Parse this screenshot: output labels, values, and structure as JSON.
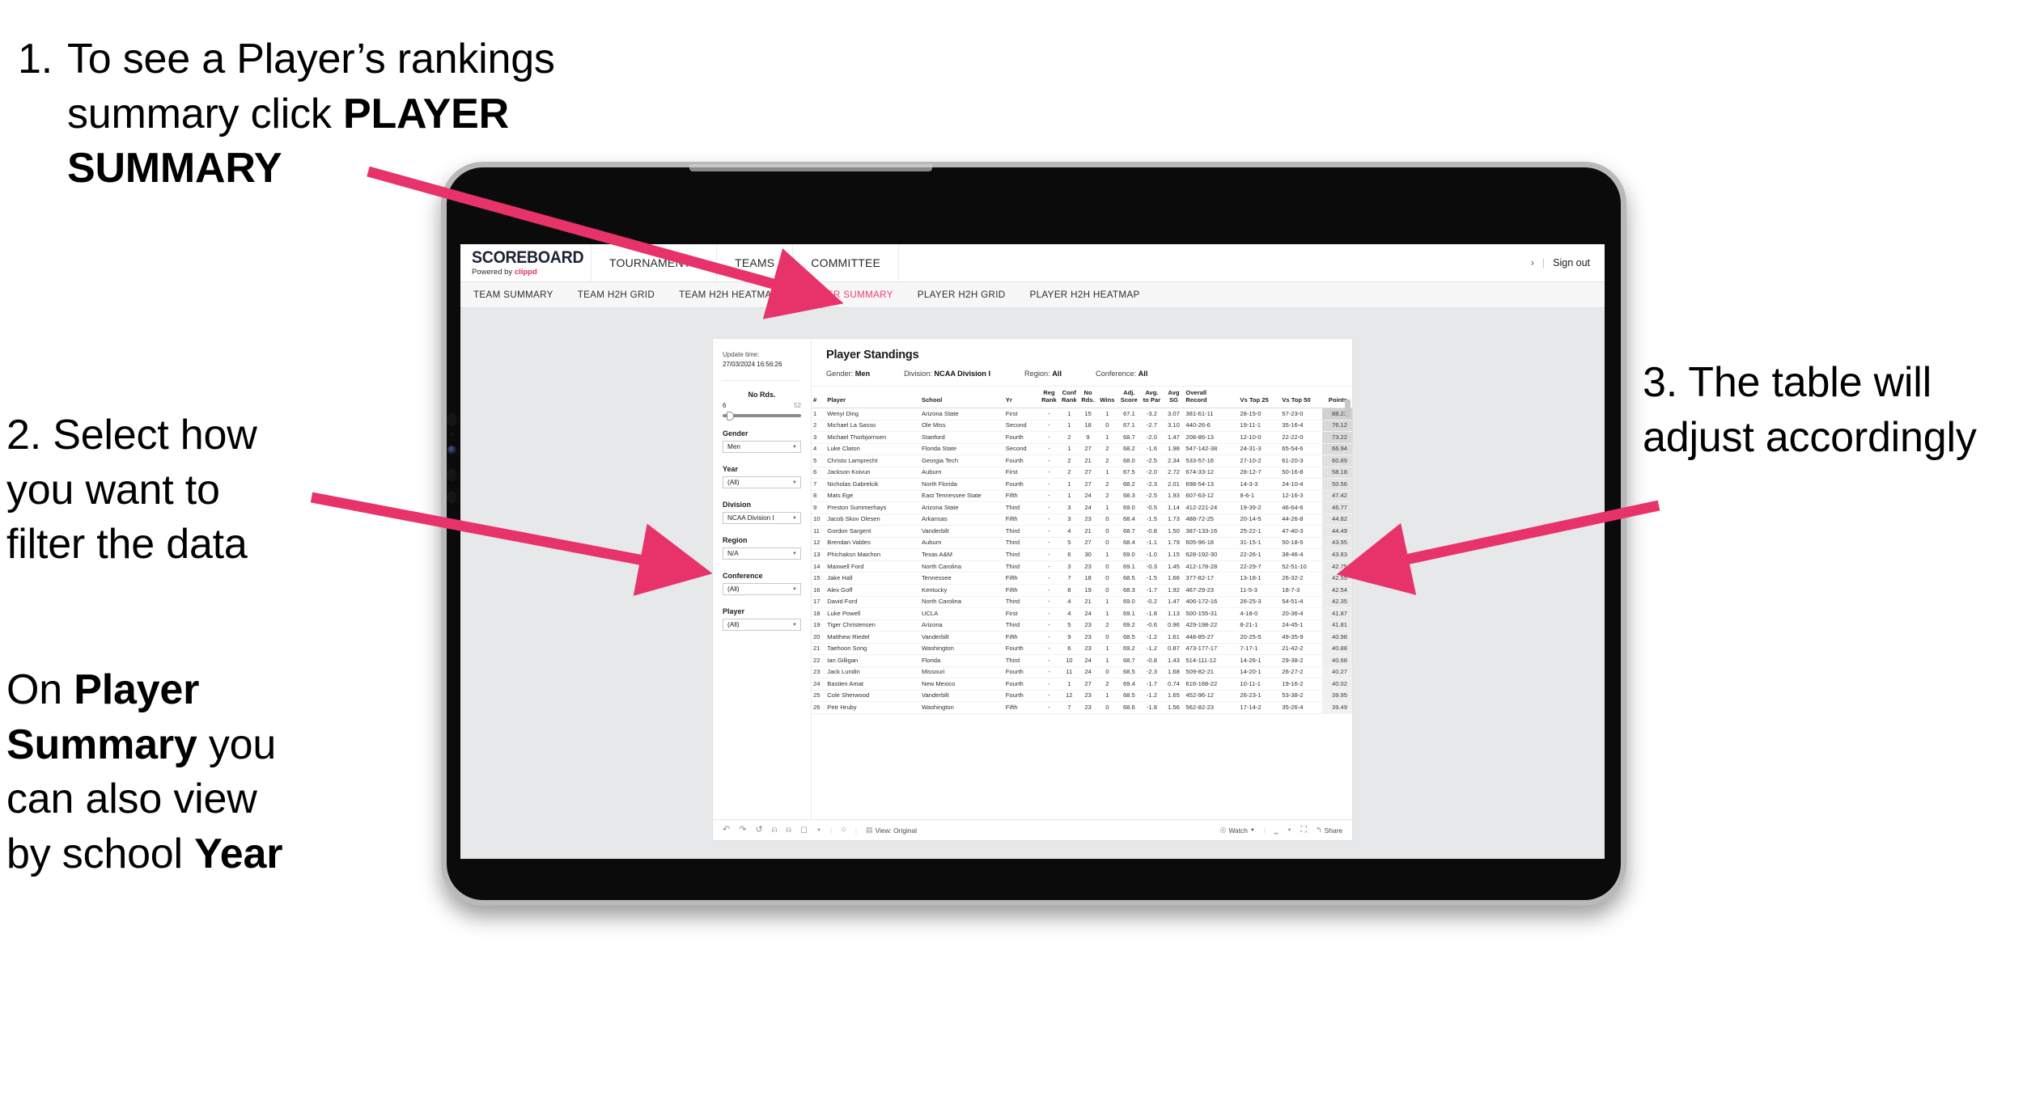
{
  "annotations": {
    "step1": {
      "number": "1.",
      "line1": "To see a Player’s rankings",
      "line2_pre": "summary click ",
      "line2_bold": "PLAYER",
      "line3_bold": "SUMMARY"
    },
    "step2": {
      "line1": "2. Select how",
      "line2": "you want to",
      "line3": "filter the data"
    },
    "step2b": {
      "line1_pre": "On ",
      "line1_bold": "Player",
      "line2_bold": "Summary",
      "line2_post": " you",
      "line3": "can also view",
      "line4_pre": "by school ",
      "line4_bold": "Year"
    },
    "step3": {
      "line1": "3. The table will",
      "line2": "adjust accordingly"
    },
    "arrow_color": "#e8336a"
  },
  "app": {
    "brand": {
      "logo": "SCOREBOARD",
      "powered_pre": "Powered by ",
      "powered_brand": "clippd",
      "brand_color": "#e2315c"
    },
    "nav": [
      {
        "label": "TOURNAMENTS",
        "name": "nav-tournaments"
      },
      {
        "label": "TEAMS",
        "name": "nav-teams"
      },
      {
        "label": "COMMITTEE",
        "name": "nav-committee"
      }
    ],
    "account": {
      "truncated": "›",
      "separator": "|",
      "sign_out": "Sign out"
    },
    "tabs": [
      {
        "label": "TEAM SUMMARY",
        "active": false
      },
      {
        "label": "TEAM H2H GRID",
        "active": false
      },
      {
        "label": "TEAM H2H HEATMAP",
        "active": false
      },
      {
        "label": "PLAYER SUMMARY",
        "active": true
      },
      {
        "label": "PLAYER H2H GRID",
        "active": false
      },
      {
        "label": "PLAYER H2H HEATMAP",
        "active": false
      }
    ],
    "active_tab_color": "#ef3e6d"
  },
  "filters": {
    "update_label": "Update time:",
    "update_time": "27/03/2024 16:56:26",
    "no_rds": {
      "label": "No Rds.",
      "min": "6",
      "max": "52",
      "handle_pct": 5
    },
    "selects": [
      {
        "label": "Gender",
        "value": "Men",
        "name": "gender-select"
      },
      {
        "label": "Year",
        "value": "(All)",
        "name": "year-select"
      },
      {
        "label": "Division",
        "value": "NCAA Division I",
        "name": "division-select"
      },
      {
        "label": "Region",
        "value": "N/A",
        "name": "region-select"
      },
      {
        "label": "Conference",
        "value": "(All)",
        "name": "conference-select"
      },
      {
        "label": "Player",
        "value": "(All)",
        "name": "player-select"
      }
    ]
  },
  "standings": {
    "title": "Player Standings",
    "meta": [
      {
        "label": "Gender:",
        "value": "Men"
      },
      {
        "label": "Division:",
        "value": "NCAA Division I"
      },
      {
        "label": "Region:",
        "value": "All"
      },
      {
        "label": "Conference:",
        "value": "All"
      }
    ],
    "columns": [
      {
        "key": "rank",
        "l1": "#",
        "l2": "",
        "cls": "c-rank"
      },
      {
        "key": "player",
        "l1": "Player",
        "l2": "",
        "cls": "c-play"
      },
      {
        "key": "school",
        "l1": "School",
        "l2": "",
        "cls": "c-sch"
      },
      {
        "key": "yr",
        "l1": "Yr",
        "l2": "",
        "cls": "c-yr"
      },
      {
        "key": "regrank",
        "l1": "Reg",
        "l2": "Rank",
        "cls": "c-rr"
      },
      {
        "key": "confrank",
        "l1": "Conf",
        "l2": "Rank",
        "cls": "c-cr"
      },
      {
        "key": "nords",
        "l1": "No",
        "l2": "Rds.",
        "cls": "c-nr"
      },
      {
        "key": "wins",
        "l1": "",
        "l2": "Wins",
        "cls": "c-wins"
      },
      {
        "key": "adj",
        "l1": "Adj.",
        "l2": "Score",
        "cls": "c-adj"
      },
      {
        "key": "atp",
        "l1": "Avg.",
        "l2": "to Par",
        "cls": "c-atp"
      },
      {
        "key": "sg",
        "l1": "Avg",
        "l2": "SG",
        "cls": "c-sg"
      },
      {
        "key": "record",
        "l1": "Overall",
        "l2": "Record",
        "cls": "c-rec"
      },
      {
        "key": "t25",
        "l1": "",
        "l2": "Vs Top 25",
        "cls": "c-t25"
      },
      {
        "key": "t50",
        "l1": "",
        "l2": "Vs Top 50",
        "cls": "c-t50"
      },
      {
        "key": "points",
        "l1": "",
        "l2": "Points",
        "cls": "c-pts"
      }
    ],
    "rows": [
      {
        "rank": "1",
        "player": "Wenyi Ding",
        "school": "Arizona State",
        "yr": "First",
        "regrank": "-",
        "confrank": "1",
        "nords": "15",
        "wins": "1",
        "adj": "67.1",
        "atp": "-3.2",
        "sg": "3.07",
        "record": "381-61-11",
        "t25": "28-15-0",
        "t50": "57-23-0",
        "points": "88.22",
        "shade": 0.28
      },
      {
        "rank": "2",
        "player": "Michael La Sasso",
        "school": "Ole Miss",
        "yr": "Second",
        "regrank": "-",
        "confrank": "1",
        "nords": "18",
        "wins": "0",
        "adj": "67.1",
        "atp": "-2.7",
        "sg": "3.10",
        "record": "440-26-6",
        "t25": "19-11-1",
        "t50": "35-16-4",
        "points": "76.12",
        "shade": 0.24
      },
      {
        "rank": "3",
        "player": "Michael Thorbjornsen",
        "school": "Stanford",
        "yr": "Fourth",
        "regrank": "-",
        "confrank": "2",
        "nords": "9",
        "wins": "1",
        "adj": "68.7",
        "atp": "-2.0",
        "sg": "1.47",
        "record": "208-86-13",
        "t25": "12-10-0",
        "t50": "22-22-0",
        "points": "73.22",
        "shade": 0.23
      },
      {
        "rank": "4",
        "player": "Luke Claton",
        "school": "Florida State",
        "yr": "Second",
        "regrank": "-",
        "confrank": "1",
        "nords": "27",
        "wins": "2",
        "adj": "68.2",
        "atp": "-1.6",
        "sg": "1.98",
        "record": "547-142-38",
        "t25": "24-31-3",
        "t50": "65-54-6",
        "points": "66.94",
        "shade": 0.21
      },
      {
        "rank": "5",
        "player": "Christo Lamprecht",
        "school": "Georgia Tech",
        "yr": "Fourth",
        "regrank": "-",
        "confrank": "2",
        "nords": "21",
        "wins": "2",
        "adj": "68.0",
        "atp": "-2.5",
        "sg": "2.34",
        "record": "533-57-16",
        "t25": "27-10-2",
        "t50": "61-20-3",
        "points": "60.89",
        "shade": 0.19
      },
      {
        "rank": "6",
        "player": "Jackson Koivun",
        "school": "Auburn",
        "yr": "First",
        "regrank": "-",
        "confrank": "2",
        "nords": "27",
        "wins": "1",
        "adj": "67.5",
        "atp": "-2.0",
        "sg": "2.72",
        "record": "674-33-12",
        "t25": "28-12-7",
        "t50": "50-16-8",
        "points": "58.18",
        "shade": 0.18
      },
      {
        "rank": "7",
        "player": "Nicholas Gabrelcik",
        "school": "North Florida",
        "yr": "Fourth",
        "regrank": "-",
        "confrank": "1",
        "nords": "27",
        "wins": "2",
        "adj": "68.2",
        "atp": "-2.3",
        "sg": "2.01",
        "record": "698-54-13",
        "t25": "14-3-3",
        "t50": "24-10-4",
        "points": "50.56",
        "shade": 0.16
      },
      {
        "rank": "8",
        "player": "Mats Ege",
        "school": "East Tennessee State",
        "yr": "Fifth",
        "regrank": "-",
        "confrank": "1",
        "nords": "24",
        "wins": "2",
        "adj": "68.3",
        "atp": "-2.5",
        "sg": "1.93",
        "record": "607-63-12",
        "t25": "8-6-1",
        "t50": "12-16-3",
        "points": "47.42",
        "shade": 0.15
      },
      {
        "rank": "9",
        "player": "Preston Summerhays",
        "school": "Arizona State",
        "yr": "Third",
        "regrank": "-",
        "confrank": "3",
        "nords": "24",
        "wins": "1",
        "adj": "69.0",
        "atp": "-0.5",
        "sg": "1.14",
        "record": "412-221-24",
        "t25": "19-39-2",
        "t50": "46-64-6",
        "points": "46.77",
        "shade": 0.15
      },
      {
        "rank": "10",
        "player": "Jacob Skov Olesen",
        "school": "Arkansas",
        "yr": "Fifth",
        "regrank": "-",
        "confrank": "3",
        "nords": "23",
        "wins": "0",
        "adj": "68.4",
        "atp": "-1.5",
        "sg": "1.73",
        "record": "488-72-25",
        "t25": "20-14-5",
        "t50": "44-26-8",
        "points": "44.82",
        "shade": 0.14
      },
      {
        "rank": "11",
        "player": "Gordon Sargent",
        "school": "Vanderbilt",
        "yr": "Third",
        "regrank": "-",
        "confrank": "4",
        "nords": "21",
        "wins": "0",
        "adj": "68.7",
        "atp": "-0.8",
        "sg": "1.50",
        "record": "387-133-16",
        "t25": "25-22-1",
        "t50": "47-40-3",
        "points": "44.49",
        "shade": 0.14
      },
      {
        "rank": "12",
        "player": "Brendan Valdes",
        "school": "Auburn",
        "yr": "Third",
        "regrank": "-",
        "confrank": "5",
        "nords": "27",
        "wins": "0",
        "adj": "68.4",
        "atp": "-1.1",
        "sg": "1.79",
        "record": "605-96-18",
        "t25": "31-15-1",
        "t50": "50-18-5",
        "points": "43.95",
        "shade": 0.13
      },
      {
        "rank": "13",
        "player": "Phichaksn Maichon",
        "school": "Texas A&M",
        "yr": "Third",
        "regrank": "-",
        "confrank": "6",
        "nords": "30",
        "wins": "1",
        "adj": "69.0",
        "atp": "-1.0",
        "sg": "1.15",
        "record": "628-192-30",
        "t25": "22-26-1",
        "t50": "38-46-4",
        "points": "43.83",
        "shade": 0.13
      },
      {
        "rank": "14",
        "player": "Maxwell Ford",
        "school": "North Carolina",
        "yr": "Third",
        "regrank": "-",
        "confrank": "3",
        "nords": "23",
        "wins": "0",
        "adj": "69.1",
        "atp": "-0.3",
        "sg": "1.45",
        "record": "412-178-28",
        "t25": "22-29-7",
        "t50": "52-51-10",
        "points": "42.75",
        "shade": 0.12
      },
      {
        "rank": "15",
        "player": "Jake Hall",
        "school": "Tennessee",
        "yr": "Fifth",
        "regrank": "-",
        "confrank": "7",
        "nords": "18",
        "wins": "0",
        "adj": "68.5",
        "atp": "-1.5",
        "sg": "1.66",
        "record": "377-82-17",
        "t25": "13-18-1",
        "t50": "26-32-2",
        "points": "42.55",
        "shade": 0.12
      },
      {
        "rank": "16",
        "player": "Alex Goff",
        "school": "Kentucky",
        "yr": "Fifth",
        "regrank": "-",
        "confrank": "8",
        "nords": "19",
        "wins": "0",
        "adj": "68.3",
        "atp": "-1.7",
        "sg": "1.92",
        "record": "467-29-23",
        "t25": "11-5-3",
        "t50": "18-7-3",
        "points": "42.54",
        "shade": 0.12
      },
      {
        "rank": "17",
        "player": "David Ford",
        "school": "North Carolina",
        "yr": "Third",
        "regrank": "-",
        "confrank": "4",
        "nords": "21",
        "wins": "1",
        "adj": "69.0",
        "atp": "-0.2",
        "sg": "1.47",
        "record": "406-172-16",
        "t25": "26-25-3",
        "t50": "54-51-4",
        "points": "42.35",
        "shade": 0.12
      },
      {
        "rank": "18",
        "player": "Luke Powell",
        "school": "UCLA",
        "yr": "First",
        "regrank": "-",
        "confrank": "4",
        "nords": "24",
        "wins": "1",
        "adj": "69.1",
        "atp": "-1.8",
        "sg": "1.13",
        "record": "500-155-31",
        "t25": "4-18-0",
        "t50": "20-36-4",
        "points": "41.87",
        "shade": 0.11
      },
      {
        "rank": "19",
        "player": "Tiger Christensen",
        "school": "Arizona",
        "yr": "Third",
        "regrank": "-",
        "confrank": "5",
        "nords": "23",
        "wins": "2",
        "adj": "69.2",
        "atp": "-0.6",
        "sg": "0.96",
        "record": "429-198-22",
        "t25": "8-21-1",
        "t50": "24-45-1",
        "points": "41.81",
        "shade": 0.11
      },
      {
        "rank": "20",
        "player": "Matthew Riedel",
        "school": "Vanderbilt",
        "yr": "Fifth",
        "regrank": "-",
        "confrank": "9",
        "nords": "23",
        "wins": "0",
        "adj": "68.5",
        "atp": "-1.2",
        "sg": "1.61",
        "record": "448-85-27",
        "t25": "20-25-5",
        "t50": "49-35-9",
        "points": "40.98",
        "shade": 0.1
      },
      {
        "rank": "21",
        "player": "Taehoon Song",
        "school": "Washington",
        "yr": "Fourth",
        "regrank": "-",
        "confrank": "6",
        "nords": "23",
        "wins": "1",
        "adj": "69.2",
        "atp": "-1.2",
        "sg": "0.87",
        "record": "473-177-17",
        "t25": "7-17-1",
        "t50": "21-42-2",
        "points": "40.88",
        "shade": 0.1
      },
      {
        "rank": "22",
        "player": "Ian Gilligan",
        "school": "Florida",
        "yr": "Third",
        "regrank": "-",
        "confrank": "10",
        "nords": "24",
        "wins": "1",
        "adj": "68.7",
        "atp": "-0.8",
        "sg": "1.43",
        "record": "514-111-12",
        "t25": "14-26-1",
        "t50": "29-38-2",
        "points": "40.68",
        "shade": 0.1
      },
      {
        "rank": "23",
        "player": "Jack Lundin",
        "school": "Missouri",
        "yr": "Fourth",
        "regrank": "-",
        "confrank": "11",
        "nords": "24",
        "wins": "0",
        "adj": "68.5",
        "atp": "-2.3",
        "sg": "1.68",
        "record": "509-82-21",
        "t25": "14-20-1",
        "t50": "26-27-2",
        "points": "40.27",
        "shade": 0.09
      },
      {
        "rank": "24",
        "player": "Bastien Amat",
        "school": "New Mexico",
        "yr": "Fourth",
        "regrank": "-",
        "confrank": "1",
        "nords": "27",
        "wins": "2",
        "adj": "69.4",
        "atp": "-1.7",
        "sg": "0.74",
        "record": "616-168-22",
        "t25": "10-11-1",
        "t50": "19-16-2",
        "points": "40.02",
        "shade": 0.09
      },
      {
        "rank": "25",
        "player": "Cole Sherwood",
        "school": "Vanderbilt",
        "yr": "Fourth",
        "regrank": "-",
        "confrank": "12",
        "nords": "23",
        "wins": "1",
        "adj": "68.5",
        "atp": "-1.2",
        "sg": "1.65",
        "record": "452-96-12",
        "t25": "26-23-1",
        "t50": "53-38-2",
        "points": "39.95",
        "shade": 0.09
      },
      {
        "rank": "26",
        "player": "Petr Hruby",
        "school": "Washington",
        "yr": "Fifth",
        "regrank": "-",
        "confrank": "7",
        "nords": "23",
        "wins": "0",
        "adj": "68.6",
        "atp": "-1.8",
        "sg": "1.56",
        "record": "562-82-23",
        "t25": "17-14-2",
        "t50": "35-26-4",
        "points": "39.49",
        "shade": 0.08
      }
    ]
  },
  "toolbar": {
    "undo": "↶",
    "redo": "↷",
    "revert": "↺",
    "refresh": "○",
    "pause": "○",
    "view_label": "View: Original",
    "watch_label": "Watch",
    "share_label": "Share"
  }
}
